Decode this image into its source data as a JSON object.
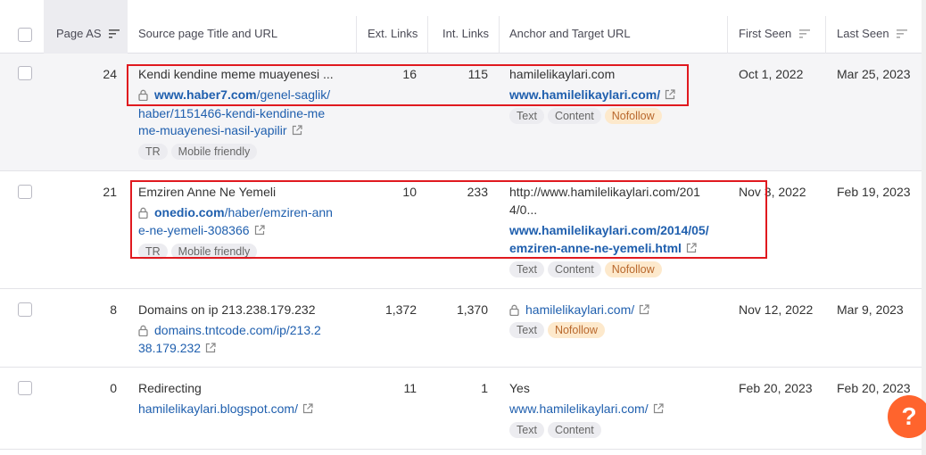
{
  "columns": {
    "page_as": "Page AS",
    "source": "Source page Title and URL",
    "ext_links": "Ext. Links",
    "int_links": "Int. Links",
    "anchor": "Anchor and Target URL",
    "first_seen": "First Seen",
    "last_seen": "Last Seen"
  },
  "rows": [
    {
      "page_as": "24",
      "title": "Kendi kendine meme muayenesi ...",
      "url_line1_domain": "www.haber7.com",
      "url_line1_rest": "/genel-saglik/",
      "url_line2": "haber/1151466-kendi-kendine-me",
      "url_line3": "me-muayenesi-nasil-yapilir",
      "source_tags": [
        "TR",
        "Mobile friendly"
      ],
      "ext_links": "16",
      "int_links": "115",
      "anchor_text": "hamilelikaylari.com",
      "target_line1": "www.hamilelikaylari.com/",
      "target_tags": [
        "Text",
        "Content",
        "Nofollow"
      ],
      "first_seen": "Oct 1, 2022",
      "last_seen": "Mar 25, 2023"
    },
    {
      "page_as": "21",
      "title": "Emziren Anne Ne Yemeli",
      "url_line1_domain": "onedio.com",
      "url_line1_rest": "/haber/emziren-ann",
      "url_line2": "e-ne-yemeli-308366",
      "source_tags": [
        "TR",
        "Mobile friendly"
      ],
      "ext_links": "10",
      "int_links": "233",
      "anchor_line1": "http://www.hamilelikaylari.com/201",
      "anchor_line2": "4/0...",
      "target_line1": "www.hamilelikaylari.com/2014/05/",
      "target_line2": "emziren-anne-ne-yemeli.html",
      "target_tags": [
        "Text",
        "Content",
        "Nofollow"
      ],
      "first_seen": "Nov 3, 2022",
      "last_seen": "Feb 19, 2023"
    },
    {
      "page_as": "8",
      "title": "Domains on ip 213.238.179.232",
      "url_line1": "domains.tntcode.com/ip/213.2",
      "url_line2": "38.179.232",
      "ext_links": "1,372",
      "int_links": "1,370",
      "target_line1": "hamilelikaylari.com/",
      "target_tags": [
        "Text",
        "Nofollow"
      ],
      "first_seen": "Nov 12, 2022",
      "last_seen": "Mar 9, 2023"
    },
    {
      "page_as": "0",
      "title": "Redirecting",
      "url_line1": "hamilelikaylari.blogspot.com/",
      "ext_links": "11",
      "int_links": "1",
      "anchor_text": "Yes",
      "target_line1": "www.hamilelikaylari.com/",
      "target_tags": [
        "Text",
        "Content"
      ],
      "first_seen": "Feb 20, 2023",
      "last_seen": "Feb 20, 2023"
    }
  ],
  "help_label": "?",
  "colors": {
    "link": "#1f5fae",
    "highlight_box": "#e0191f",
    "nofollow_bg": "#fde9cc",
    "help_button": "#ff642d"
  }
}
